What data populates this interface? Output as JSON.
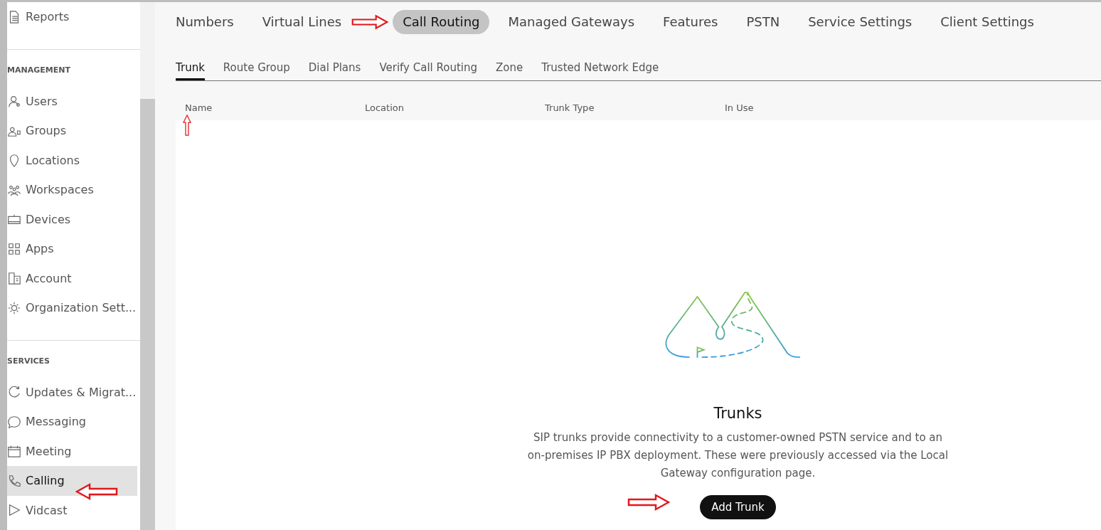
{
  "sidebar": {
    "sections": [
      {
        "items": [
          {
            "label": "Reports",
            "selected": false
          }
        ]
      },
      {
        "heading": "MANAGEMENT",
        "items": [
          {
            "label": "Users",
            "selected": false
          },
          {
            "label": "Groups",
            "selected": false
          },
          {
            "label": "Locations",
            "selected": false
          },
          {
            "label": "Workspaces",
            "selected": false
          },
          {
            "label": "Devices",
            "selected": false
          },
          {
            "label": "Apps",
            "selected": false
          },
          {
            "label": "Account",
            "selected": false
          },
          {
            "label": "Organization Sett...",
            "selected": false
          }
        ]
      },
      {
        "heading": "SERVICES",
        "items": [
          {
            "label": "Updates & Migrat...",
            "selected": false
          },
          {
            "label": "Messaging",
            "selected": false
          },
          {
            "label": "Meeting",
            "selected": false
          },
          {
            "label": "Calling",
            "selected": true
          },
          {
            "label": "Vidcast",
            "selected": false
          }
        ]
      }
    ]
  },
  "tabs": [
    {
      "label": "Numbers",
      "selected": false
    },
    {
      "label": "Virtual Lines",
      "selected": false
    },
    {
      "label": "Call Routing",
      "selected": true
    },
    {
      "label": "Managed Gateways",
      "selected": false
    },
    {
      "label": "Features",
      "selected": false
    },
    {
      "label": "PSTN",
      "selected": false
    },
    {
      "label": "Service Settings",
      "selected": false
    },
    {
      "label": "Client Settings",
      "selected": false
    }
  ],
  "subtabs": [
    {
      "label": "Trunk",
      "selected": true
    },
    {
      "label": "Route Group",
      "selected": false
    },
    {
      "label": "Dial Plans",
      "selected": false
    },
    {
      "label": "Verify Call Routing",
      "selected": false
    },
    {
      "label": "Zone",
      "selected": false
    },
    {
      "label": "Trusted Network Edge",
      "selected": false
    }
  ],
  "table": {
    "columns": [
      "Name",
      "Location",
      "Trunk Type",
      "In Use"
    ]
  },
  "empty_state": {
    "title": "Trunks",
    "description": "SIP trunks provide connectivity to a customer-owned PSTN service and to an on-premises IP PBX deployment. These were previously accessed via the Local Gateway configuration page.",
    "button": "Add Trunk"
  }
}
